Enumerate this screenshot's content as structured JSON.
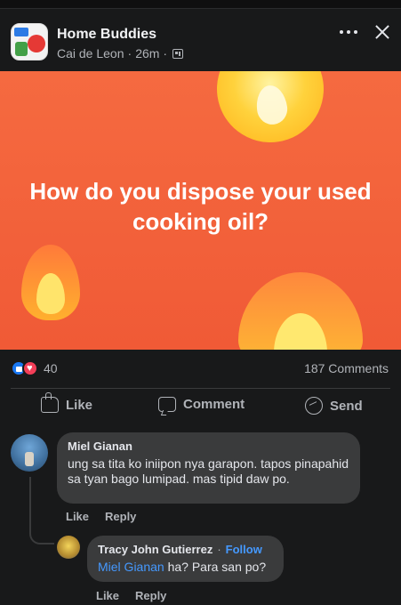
{
  "post": {
    "group_name": "Home Buddies",
    "author": "Cai de Leon",
    "separator": "·",
    "time": "26m",
    "image_text": "How do you dispose your used cooking oil?",
    "reaction_count": "40",
    "comments_count": "187 Comments"
  },
  "actions": {
    "like": "Like",
    "comment": "Comment",
    "send": "Send"
  },
  "comments": [
    {
      "author": "Miel Gianan",
      "text": "ung sa tita ko iniipon nya garapon. tapos pinapahid sa tyan bago lumipad. mas tipid daw po.",
      "like": "Like",
      "reply": "Reply"
    }
  ],
  "reply": {
    "author": "Tracy John Gutierrez",
    "separator": "·",
    "follow": "Follow",
    "mention": "Miel Gianan",
    "text": " ha? Para san po?",
    "like": "Like",
    "reply": "Reply"
  },
  "colors": {
    "background": "#18191a",
    "bubble": "#3a3b3c",
    "accent_blue": "#4599ff",
    "image_orange": "#f56a40"
  }
}
